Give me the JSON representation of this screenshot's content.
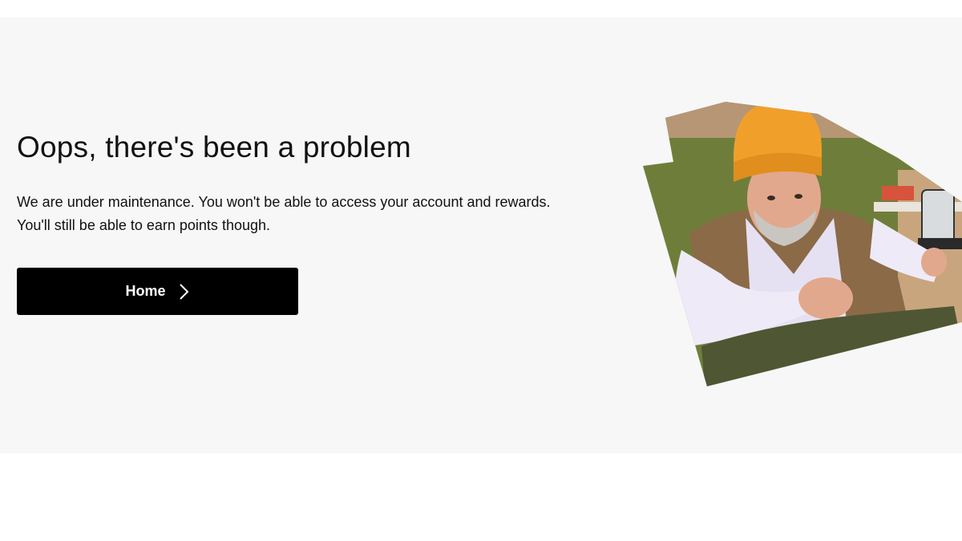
{
  "error": {
    "title": "Oops, there's been a problem",
    "message": "We are under maintenance. You won't be able to access your account and rewards. You'll still be able to earn points though."
  },
  "actions": {
    "home_label": "Home",
    "home_icon": "chevron-right-icon"
  },
  "colors": {
    "banner_background": "#f7f7f7",
    "button_background": "#000000",
    "button_text": "#ffffff",
    "text": "#111111"
  },
  "illustration": {
    "subject": "man in orange beanie"
  }
}
